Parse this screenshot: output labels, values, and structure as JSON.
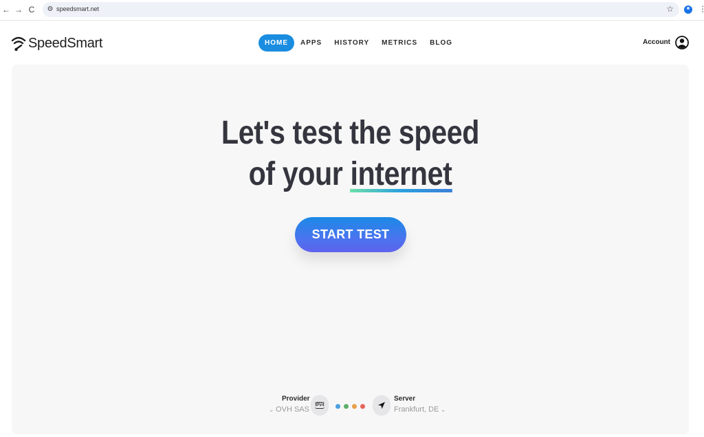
{
  "browser": {
    "url": "speedsmart.net",
    "back_icon": "←",
    "forward_icon": "→",
    "reload_icon": "C",
    "site_info_icon": "⚙",
    "star_icon": "☆",
    "menu_icon": "⋮"
  },
  "header": {
    "logo_text": "SpeedSmart",
    "nav": [
      {
        "label": "HOME",
        "active": true
      },
      {
        "label": "APPS",
        "active": false
      },
      {
        "label": "HISTORY",
        "active": false
      },
      {
        "label": "METRICS",
        "active": false
      },
      {
        "label": "BLOG",
        "active": false
      }
    ],
    "account_label": "Account"
  },
  "hero": {
    "line1": "Let's test the speed",
    "line2_prefix": "of your ",
    "line2_highlight": "internet",
    "start_button": "START TEST"
  },
  "info": {
    "provider_label": "Provider",
    "provider_value": "OVH SAS",
    "ip_version": "IPV4",
    "server_label": "Server",
    "server_value": "Frankfurt, DE",
    "dot_colors": [
      "#4a9fe0",
      "#5cae6a",
      "#eaa04a",
      "#e8635a"
    ]
  },
  "colors": {
    "accent": "#1a8de0",
    "text_dark": "#35353f",
    "card_bg": "#f7f7f7"
  }
}
